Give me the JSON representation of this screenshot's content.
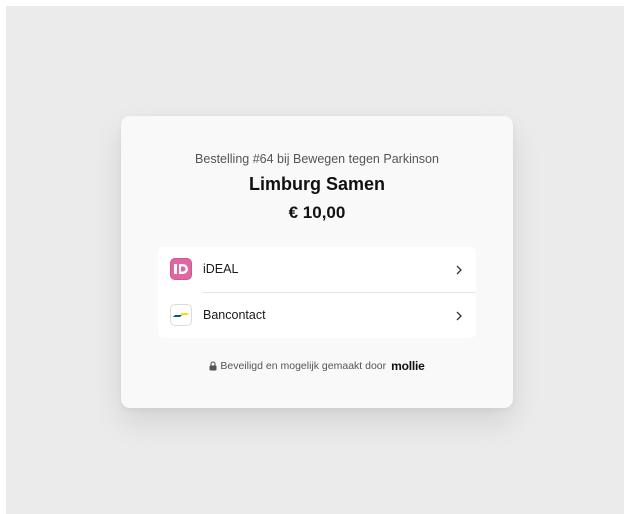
{
  "checkout": {
    "order_line": "Bestelling #64 bij Bewegen tegen Parkinson",
    "merchant": "Limburg Samen",
    "amount": "€ 10,00"
  },
  "methods": [
    {
      "label": "iDEAL",
      "icon": "ideal-logo-icon",
      "color": "#e0679f"
    },
    {
      "label": "Bancontact",
      "icon": "bancontact-logo-icon",
      "color": "#005498"
    }
  ],
  "footer": {
    "text": "Beveiligd en mogelijk gemaakt door",
    "brand": "mollie",
    "icon": "lock-icon"
  }
}
